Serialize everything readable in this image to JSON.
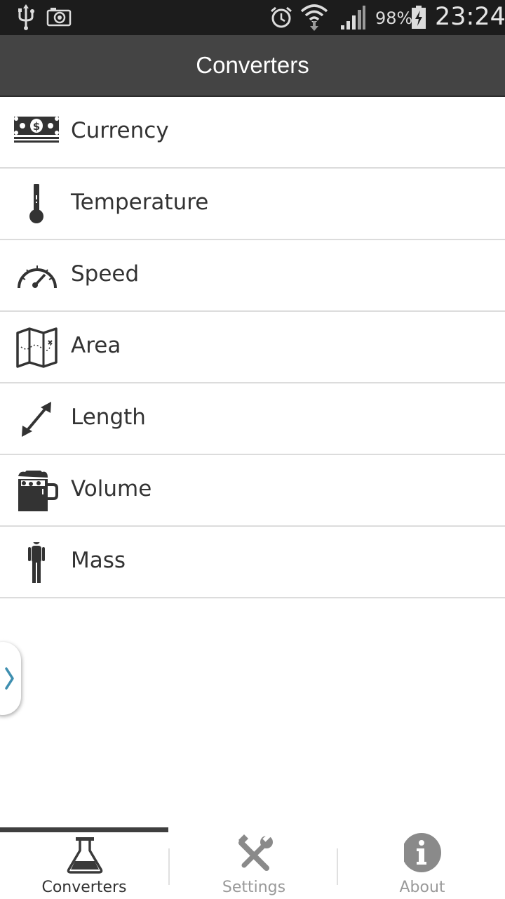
{
  "status_bar": {
    "battery_percent": "98%",
    "time": "23:24",
    "icons": [
      "usb-icon",
      "screenshot-icon",
      "alarm-icon",
      "wifi-icon",
      "signal-icon",
      "battery-charging-icon"
    ]
  },
  "app_bar": {
    "title": "Converters"
  },
  "converters": [
    {
      "label": "Currency",
      "icon": "currency-icon"
    },
    {
      "label": "Temperature",
      "icon": "thermometer-icon"
    },
    {
      "label": "Speed",
      "icon": "speedometer-icon"
    },
    {
      "label": "Area",
      "icon": "map-icon"
    },
    {
      "label": "Length",
      "icon": "diagonal-arrow-icon"
    },
    {
      "label": "Volume",
      "icon": "beer-mug-icon"
    },
    {
      "label": "Mass",
      "icon": "person-icon"
    }
  ],
  "tabs": [
    {
      "label": "Converters",
      "icon": "flask-icon",
      "active": true
    },
    {
      "label": "Settings",
      "icon": "tools-icon",
      "active": false
    },
    {
      "label": "About",
      "icon": "info-icon",
      "active": false
    }
  ],
  "colors": {
    "status_bar_bg": "#1c1c1c",
    "app_bar_bg": "#444444",
    "icon_dark": "#333333",
    "icon_inactive": "#8a8a8a",
    "handle_chevron": "#3f8fb0"
  }
}
